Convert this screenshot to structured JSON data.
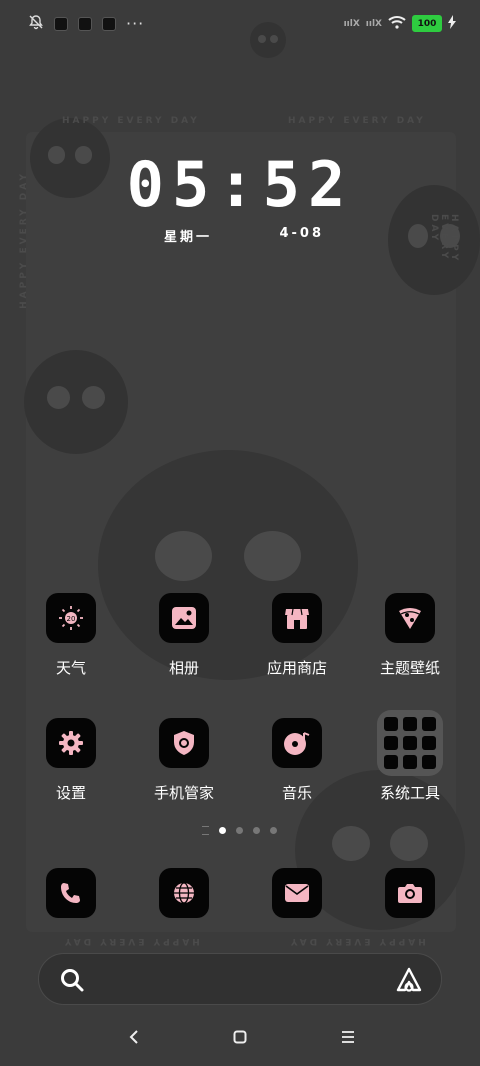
{
  "status_bar": {
    "battery": "100",
    "signal_1": "ıılX",
    "signal_2": "ıılX",
    "more": "···"
  },
  "lockscreen": {
    "time": "05:52",
    "weekday": "星期一",
    "date": "4-08"
  },
  "apps": [
    {
      "label": "天气",
      "icon": "weather-icon"
    },
    {
      "label": "相册",
      "icon": "gallery-icon"
    },
    {
      "label": "应用商店",
      "icon": "store-icon"
    },
    {
      "label": "主题壁纸",
      "icon": "theme-icon"
    },
    {
      "label": "设置",
      "icon": "settings-icon"
    },
    {
      "label": "手机管家",
      "icon": "security-icon"
    },
    {
      "label": "音乐",
      "icon": "music-icon"
    },
    {
      "label": "系统工具",
      "icon": "folder-icon"
    }
  ],
  "dock": [
    "phone-icon",
    "browser-icon",
    "messages-icon",
    "camera-icon"
  ],
  "pager": {
    "pages": 4,
    "active": 0
  },
  "wallpaper_text": {
    "top": "HAPPY EVERY DAY",
    "side": "HAPPY EVERY DAY"
  },
  "weather_icon_text": "20",
  "colors": {
    "accent": "#f4b6c2",
    "icon_bg": "#050505",
    "background": "#3b3b3b"
  }
}
